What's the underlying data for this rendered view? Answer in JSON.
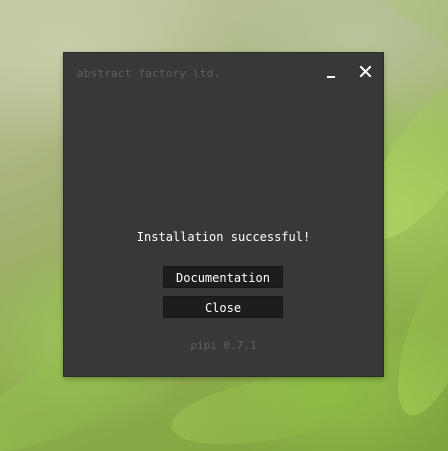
{
  "window": {
    "title": "abstract factory ltd.",
    "minimize_icon": "minimize-icon",
    "close_icon": "close-icon"
  },
  "dialog": {
    "message": "Installation successful!",
    "documentation_label": "Documentation",
    "close_label": "Close",
    "version": "pipi 0.7.1"
  },
  "colors": {
    "window_bg": "#383838",
    "button_bg": "#1d1d1d",
    "muted_text": "#5f5f5f",
    "text": "#ffffff"
  }
}
